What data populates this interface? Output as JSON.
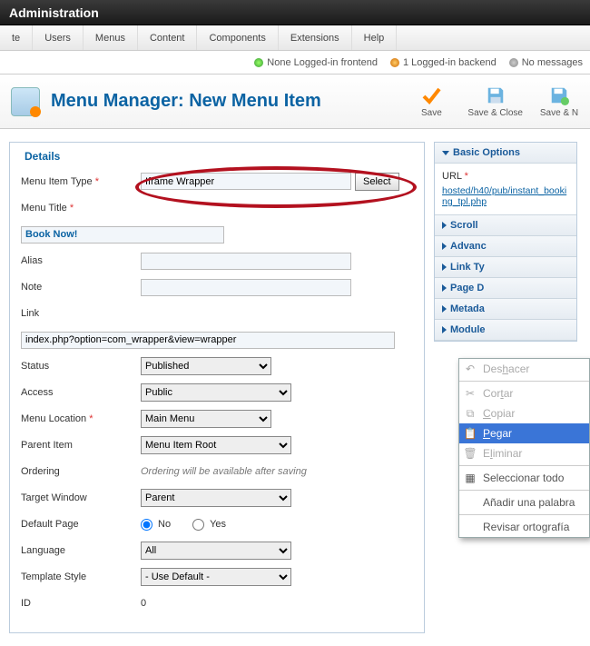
{
  "app": {
    "title": "Administration"
  },
  "topmenu": {
    "items": [
      "te",
      "Users",
      "Menus",
      "Content",
      "Components",
      "Extensions",
      "Help"
    ]
  },
  "status": {
    "frontend_count": "0",
    "frontend_label": "None Logged-in frontend",
    "backend_count": "1",
    "backend_label": "1 Logged-in backend",
    "messages": "No messages"
  },
  "page": {
    "title": "Menu Manager: New Menu Item"
  },
  "toolbar": {
    "save": "Save",
    "saveclose": "Save & Close",
    "savenew": "Save & N"
  },
  "details": {
    "legend": "Details",
    "labels": {
      "type": "Menu Item Type",
      "title": "Menu Title",
      "alias": "Alias",
      "note": "Note",
      "link": "Link",
      "status": "Status",
      "access": "Access",
      "location": "Menu Location",
      "parent": "Parent Item",
      "ordering": "Ordering",
      "target": "Target Window",
      "defaultpage": "Default Page",
      "language": "Language",
      "tplstyle": "Template Style",
      "id": "ID"
    },
    "values": {
      "type": "Iframe Wrapper",
      "type_select_btn": "Select",
      "title": "Book Now!",
      "alias": "",
      "note": "",
      "link": "index.php?option=com_wrapper&view=wrapper",
      "status": "Published",
      "access": "Public",
      "location": "Main Menu",
      "parent": "Menu Item Root",
      "order_note": "Ordering will be available after saving",
      "target": "Parent",
      "radio_no": "No",
      "radio_yes": "Yes",
      "language": "All",
      "tplstyle": "- Use Default -",
      "id": "0"
    }
  },
  "right": {
    "basic": {
      "title": "Basic Options",
      "url_label": "URL",
      "url_value": "hosted/h40/pub/instant_booking_tpl.php"
    },
    "sections": {
      "scroll": "Scroll",
      "advanced": "Advanc",
      "linktype": "Link Ty",
      "pagedisplay": "Page D",
      "metadata": "Metada",
      "module": "Module"
    }
  },
  "ctx": {
    "undo": "Deshacer",
    "cut": "Cortar",
    "copy": "Copiar",
    "paste": "Pegar",
    "delete": "Eliminar",
    "selectall": "Seleccionar todo",
    "addword": "Añadir una palabra",
    "spellcheck": "Revisar ortografía"
  }
}
